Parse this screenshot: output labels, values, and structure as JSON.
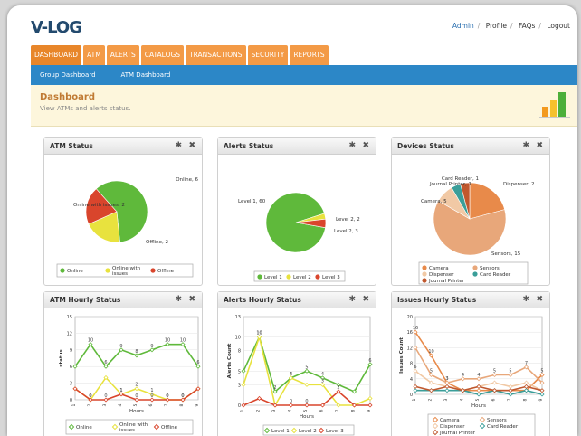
{
  "header": {
    "logo": "V-LOG",
    "links": {
      "admin": "Admin",
      "profile": "Profile",
      "faqs": "FAQs",
      "logout": "Logout"
    }
  },
  "tabs": [
    "DASHBOARD",
    "ATM",
    "ALERTS",
    "CATALOGS",
    "TRANSACTIONS",
    "SECURITY",
    "REPORTS"
  ],
  "subnav": [
    "Group Dashboard",
    "ATM Dashboard"
  ],
  "dashboard": {
    "title": "Dashboard",
    "subtitle": "View ATMs and alerts status."
  },
  "panels": {
    "atm_status": "ATM Status",
    "alerts_status": "Alerts Status",
    "devices_status": "Devices Status",
    "atm_hourly": "ATM Hourly Status",
    "alerts_hourly": "Alerts Hourly Status",
    "issues_hourly": "Issues Hourly Status"
  },
  "colors": {
    "online": "#5fb93b",
    "issues": "#e8e23e",
    "offline": "#d9452c",
    "camera": "#e88a4a",
    "sensors": "#e8a77a",
    "dispenser": "#f1c9a5",
    "card_reader": "#3a9e99",
    "journal": "#c0582e",
    "accent": "#f39a46",
    "nav": "#2c87c7"
  },
  "chart_data": [
    {
      "type": "pie",
      "title": "ATM Status",
      "labels": [
        "Online",
        "Online with issues",
        "Offline"
      ],
      "values": [
        6,
        2,
        2
      ],
      "slice_labels": [
        "Online, 6",
        "Online with issues, 2",
        "Offline, 2"
      ],
      "legend": [
        "Online",
        "Online with issues",
        "Offline"
      ]
    },
    {
      "type": "pie",
      "title": "Alerts Status",
      "labels": [
        "Level 1",
        "Level 2",
        "Level 3"
      ],
      "values": [
        60,
        2,
        3
      ],
      "slice_labels": [
        "Level 1, 60",
        "Level 2, 2",
        "Level 2, 3"
      ],
      "legend": [
        "Level 1",
        "Level 2",
        "Level 3"
      ]
    },
    {
      "type": "pie",
      "title": "Devices Status",
      "labels": [
        "Camera",
        "Sensors",
        "Dispenser",
        "Card Reader",
        "Journal Printer"
      ],
      "values": [
        5,
        15,
        2,
        1,
        1
      ],
      "slice_labels": [
        "Camera, 5",
        "Sensors, 15",
        "Dispenser, 2",
        "Card Reader, 1",
        "Journal Printer, 1"
      ],
      "legend": [
        "Camera",
        "Sensors",
        "Dispenser",
        "Card Reader",
        "Journal Printer"
      ]
    },
    {
      "type": "line",
      "title": "ATM Hourly Status",
      "xlabel": "Hours",
      "ylabel": "status",
      "ylim": [
        0,
        15
      ],
      "yticks": [
        0,
        3,
        6,
        9,
        12,
        15
      ],
      "x": [
        "1",
        "2",
        "3",
        "4",
        "5",
        "6",
        "7",
        "8",
        "9"
      ],
      "series": [
        {
          "name": "Online",
          "values": [
            6,
            10,
            6,
            9,
            8,
            9,
            10,
            10,
            6
          ]
        },
        {
          "name": "Online with issues",
          "values": [
            2,
            0,
            4,
            1,
            2,
            1,
            0,
            0,
            2
          ]
        },
        {
          "name": "Offline",
          "values": [
            2,
            0,
            0,
            1,
            0,
            0,
            0,
            0,
            2
          ]
        }
      ],
      "point_labels": {
        "Online": [
          "",
          "10",
          "6",
          "9",
          "8",
          "9",
          "10",
          "10",
          "6"
        ],
        "Online with issues": [
          "",
          "0",
          "",
          "1",
          "2",
          "1",
          "0",
          "0",
          ""
        ],
        "Offline": [
          "",
          "0",
          "0",
          "1",
          "0",
          "0",
          "0",
          "0",
          ""
        ]
      }
    },
    {
      "type": "line",
      "title": "Alerts Hourly Status",
      "xlabel": "Hours",
      "ylabel": "Alerts Count",
      "ylim": [
        0,
        13
      ],
      "yticks": [
        0,
        3,
        5,
        8,
        10,
        13
      ],
      "x": [
        "1",
        "2",
        "3",
        "4",
        "5",
        "6",
        "7",
        "8",
        "9"
      ],
      "series": [
        {
          "name": "Level 1",
          "values": [
            5,
            10,
            2,
            4,
            5,
            4,
            3,
            2,
            6
          ]
        },
        {
          "name": "Level 2",
          "values": [
            3,
            10,
            0,
            4,
            3,
            3,
            0,
            0,
            1
          ]
        },
        {
          "name": "Level 3",
          "values": [
            0,
            1,
            0,
            0,
            0,
            0,
            2,
            0,
            0
          ]
        }
      ],
      "point_labels": {
        "Level 1": [
          "",
          "10",
          "2",
          "4",
          "5",
          "4",
          "",
          "",
          "6"
        ],
        "Level 2": [
          "",
          "10",
          "",
          "4",
          "",
          "3",
          "",
          "",
          ""
        ],
        "Level 3": [
          "",
          "",
          "",
          "0",
          "0",
          "",
          "2",
          "",
          ""
        ]
      }
    },
    {
      "type": "line",
      "title": "Issues Hourly Status",
      "xlabel": "Hours",
      "ylabel": "Issues Count",
      "ylim": [
        0,
        20
      ],
      "yticks": [
        0,
        4,
        8,
        12,
        16,
        20
      ],
      "x": [
        "1",
        "2",
        "3",
        "4",
        "5",
        "6",
        "7",
        "8",
        "9"
      ],
      "series": [
        {
          "name": "Camera",
          "values": [
            16,
            10,
            3,
            1,
            1,
            1,
            1,
            1,
            5
          ]
        },
        {
          "name": "Sensors",
          "values": [
            12,
            5,
            3,
            4,
            4,
            5,
            5,
            7,
            3
          ]
        },
        {
          "name": "Dispenser",
          "values": [
            6,
            3,
            2,
            1,
            2,
            3,
            2,
            3,
            1
          ]
        },
        {
          "name": "Card Reader",
          "values": [
            1,
            1,
            1,
            1,
            0,
            1,
            0,
            1,
            0
          ]
        },
        {
          "name": "Journal Printer",
          "values": [
            2,
            1,
            2,
            1,
            2,
            1,
            1,
            2,
            1
          ]
        }
      ],
      "point_labels": {
        "Camera": [
          "16",
          "10",
          "3",
          "",
          "",
          "",
          "",
          "",
          "5"
        ],
        "Sensors": [
          "",
          "5",
          "3",
          "4",
          "4",
          "5",
          "5",
          "7",
          ""
        ],
        "Dispenser": [
          "6",
          "",
          "",
          "",
          "",
          "",
          "",
          "",
          ""
        ],
        "Card Reader": [],
        "Journal Printer": []
      }
    }
  ]
}
